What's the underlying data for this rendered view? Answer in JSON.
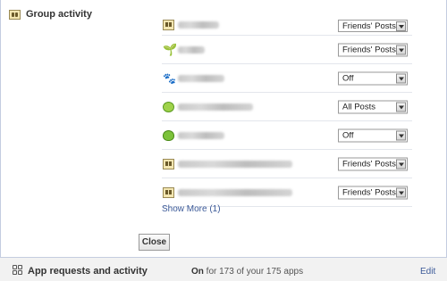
{
  "group_activity": {
    "title": "Group activity",
    "rows": [
      {
        "icon": "group-icon",
        "value": "Friends' Posts"
      },
      {
        "icon": "leaf-icon",
        "value": "Friends' Posts"
      },
      {
        "icon": "paw-icon",
        "value": "Off"
      },
      {
        "icon": "ball-icon",
        "value": "All Posts"
      },
      {
        "icon": "apple-icon",
        "value": "Off"
      },
      {
        "icon": "group-icon",
        "value": "Friends' Posts"
      },
      {
        "icon": "group-icon",
        "value": "Friends' Posts"
      }
    ],
    "show_more": "Show More (1)",
    "close_label": "Close"
  },
  "app_requests": {
    "title": "App requests and activity",
    "status_on": "On",
    "status_rest": "for 173 of your 175 apps",
    "edit_label": "Edit"
  },
  "colors": {
    "link": "#3b5998",
    "border": "#c4cde0"
  }
}
